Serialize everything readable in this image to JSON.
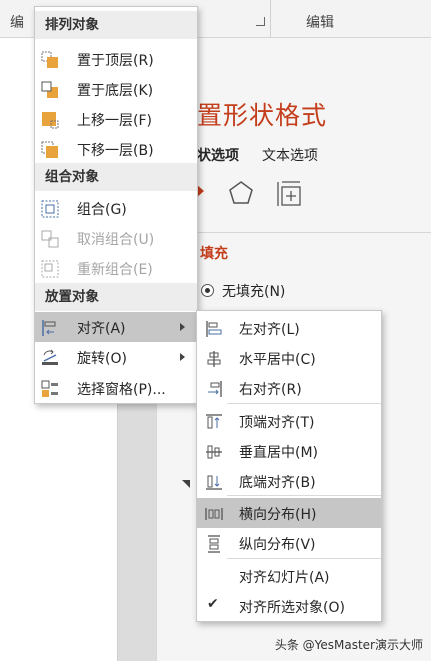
{
  "ribbon": {
    "left_label": "编",
    "right_label": "编辑"
  },
  "panel": {
    "title": "置形状格式",
    "tab_shape": "状选项",
    "tab_text": "文本选项",
    "fill_header": "填充",
    "no_fill": "无填充(N)"
  },
  "menu_main": {
    "section_arrange": "排列对象",
    "bring_front": "置于顶层(R)",
    "send_back": "置于底层(K)",
    "bring_forward": "上移一层(F)",
    "send_backward": "下移一层(B)",
    "section_group": "组合对象",
    "group": "组合(G)",
    "ungroup": "取消组合(U)",
    "regroup": "重新组合(E)",
    "section_position": "放置对象",
    "align": "对齐(A)",
    "rotate": "旋转(O)",
    "selection_pane": "选择窗格(P)..."
  },
  "menu_align": {
    "align_left": "左对齐(L)",
    "align_center": "水平居中(C)",
    "align_right": "右对齐(R)",
    "align_top": "顶端对齐(T)",
    "align_middle": "垂直居中(M)",
    "align_bottom": "底端对齐(B)",
    "distribute_h": "横向分布(H)",
    "distribute_v": "纵向分布(V)",
    "align_slide": "对齐幻灯片(A)",
    "align_selected": "对齐所选对象(O)"
  },
  "watermark": "头条 @YesMaster演示大师",
  "colors": {
    "accent": "#c43e1c",
    "highlight": "#c6c6c6",
    "icon_orange": "#e8a33d"
  }
}
